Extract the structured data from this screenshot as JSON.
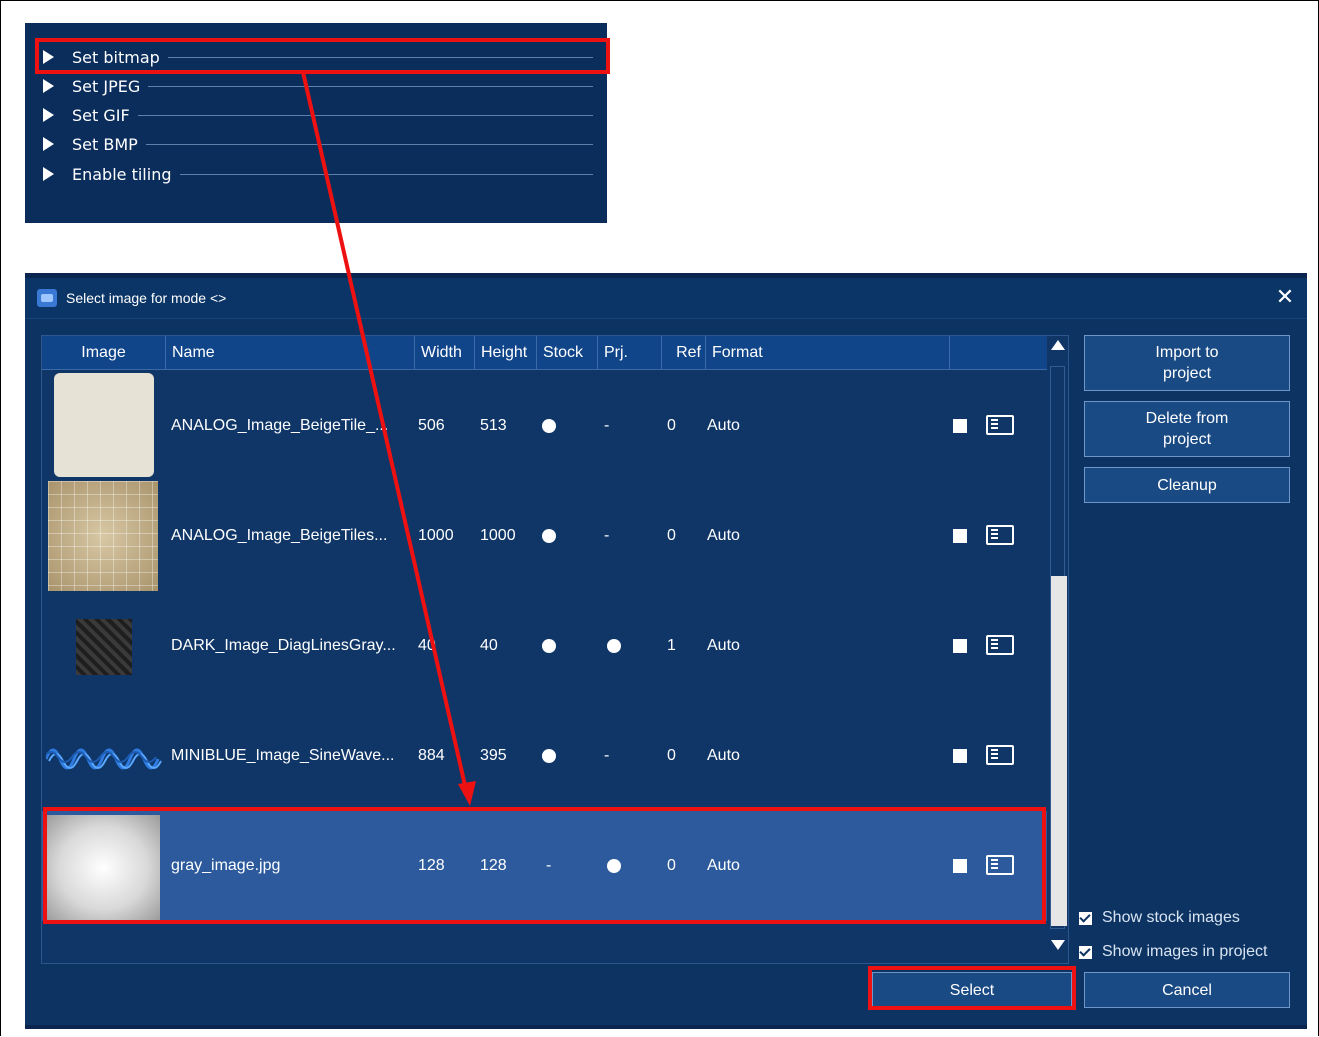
{
  "menu": {
    "items": [
      {
        "label": "Set bitmap"
      },
      {
        "label": "Set JPEG"
      },
      {
        "label": "Set GIF"
      },
      {
        "label": "Set BMP"
      },
      {
        "label": "Enable tiling"
      }
    ]
  },
  "dialog": {
    "title": "Select image for mode <>",
    "close_glyph": "✕",
    "columns": {
      "image": "Image",
      "name": "Name",
      "width": "Width",
      "height": "Height",
      "stock": "Stock",
      "prj": "Prj.",
      "ref": "Ref",
      "format": "Format"
    },
    "rows": [
      {
        "name": "ANALOG_Image_BeigeTile_...",
        "width": "506",
        "height": "513",
        "stock": "dot",
        "prj": "-",
        "ref": "0",
        "format": "Auto",
        "thumb": "beige-tile",
        "selected": false
      },
      {
        "name": "ANALOG_Image_BeigeTiles...",
        "width": "1000",
        "height": "1000",
        "stock": "dot",
        "prj": "-",
        "ref": "0",
        "format": "Auto",
        "thumb": "beige-grid",
        "selected": false
      },
      {
        "name": "DARK_Image_DiagLinesGray...",
        "width": "40",
        "height": "40",
        "stock": "dot",
        "prj": "dot",
        "ref": "1",
        "format": "Auto",
        "thumb": "diag-lines",
        "selected": false
      },
      {
        "name": "MINIBLUE_Image_SineWave...",
        "width": "884",
        "height": "395",
        "stock": "dot",
        "prj": "-",
        "ref": "0",
        "format": "Auto",
        "thumb": "sine-wave",
        "selected": false
      },
      {
        "name": "gray_image.jpg",
        "width": "128",
        "height": "128",
        "stock": "-",
        "prj": "dot",
        "ref": "0",
        "format": "Auto",
        "thumb": "gray-gradient",
        "selected": true
      }
    ],
    "buttons": {
      "import": "Import to project",
      "delete": "Delete from project",
      "cleanup": "Cleanup",
      "select": "Select",
      "cancel": "Cancel"
    },
    "checkboxes": {
      "show_stock": "Show stock images",
      "show_project": "Show images in project"
    }
  },
  "colors": {
    "dialog_bg": "#0d3362",
    "header_bg": "#10458a",
    "selected_row": "#2c5a9c",
    "annotation_red": "#ee1111"
  }
}
